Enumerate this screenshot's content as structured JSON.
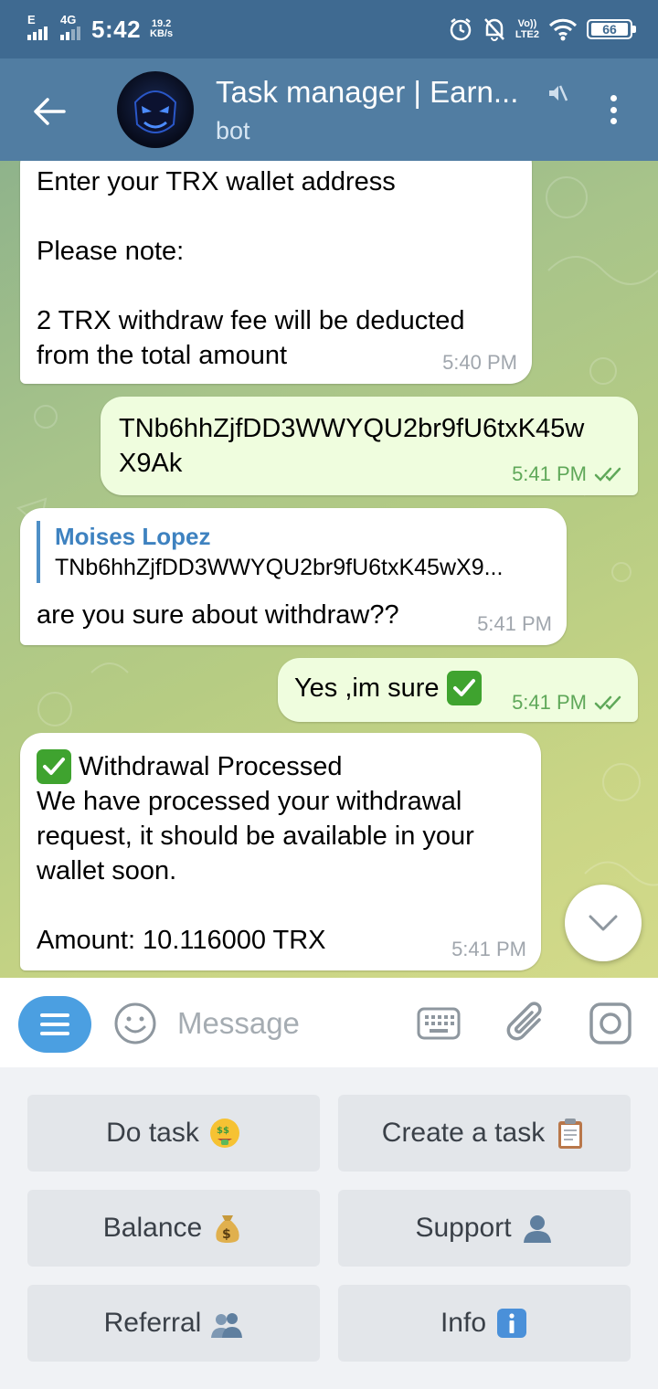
{
  "status_bar": {
    "network_label": "E",
    "network_gen": "4G",
    "time": "5:42",
    "speed_value": "19.2",
    "speed_unit": "KB/s",
    "volte_label": "Vo))",
    "lte_label": "LTE2",
    "battery": "66",
    "icons": [
      "alarm-icon",
      "mute-notifications-icon",
      "wifi-icon",
      "battery-icon"
    ]
  },
  "header": {
    "title": "Task manager | Earn...",
    "subtitle": "bot",
    "icons": [
      "back-arrow-icon",
      "muted-speaker-icon",
      "more-vert-icon"
    ]
  },
  "messages": [
    {
      "direction": "incoming",
      "text": "Enter your TRX wallet address\n\nPlease note:\n\n2 TRX withdraw fee will be deducted\nfrom the total amount",
      "time": "5:40 PM"
    },
    {
      "direction": "outgoing",
      "text": "TNb6hhZjfDD3WWYQU2br9fU6txK45w\nX9Ak",
      "time": "5:41 PM",
      "status": "read"
    },
    {
      "direction": "incoming",
      "reply_to_name": "Moises Lopez",
      "reply_to_text": "TNb6hhZjfDD3WWYQU2br9fU6txK45wX9...",
      "text": "are you sure about withdraw??",
      "time": "5:41 PM"
    },
    {
      "direction": "outgoing",
      "text": "Yes ,im sure",
      "emoji": "check-mark-button",
      "time": "5:41 PM",
      "status": "read"
    },
    {
      "direction": "incoming",
      "emoji": "check-mark-button",
      "title": "Withdrawal Processed",
      "text": "We have processed your withdrawal\nrequest, it should be available in your\nwallet soon.\n\nAmount: 10.116000 TRX",
      "time": "5:41 PM"
    }
  ],
  "input_bar": {
    "placeholder": "Message",
    "value": "",
    "icons": [
      "bot-menu-icon",
      "emoji-icon",
      "keyboard-icon",
      "attach-icon",
      "camera-icon"
    ]
  },
  "keyboard_buttons": [
    {
      "label": "Do task",
      "emoji": "money-mouth-face"
    },
    {
      "label": "Create a task",
      "emoji": "clipboard"
    },
    {
      "label": "Balance",
      "emoji": "money-bag"
    },
    {
      "label": "Support",
      "emoji": "bust-in-silhouette"
    },
    {
      "label": "Referral",
      "emoji": "busts-in-silhouette"
    },
    {
      "label": "Info",
      "emoji": "information"
    }
  ],
  "colors": {
    "header": "#517da2",
    "status_bar": "#3f6a91",
    "outgoing_bubble": "#effdde",
    "incoming_bubble": "#ffffff",
    "accent": "#4b9fe1",
    "read_check": "#5fa859"
  }
}
